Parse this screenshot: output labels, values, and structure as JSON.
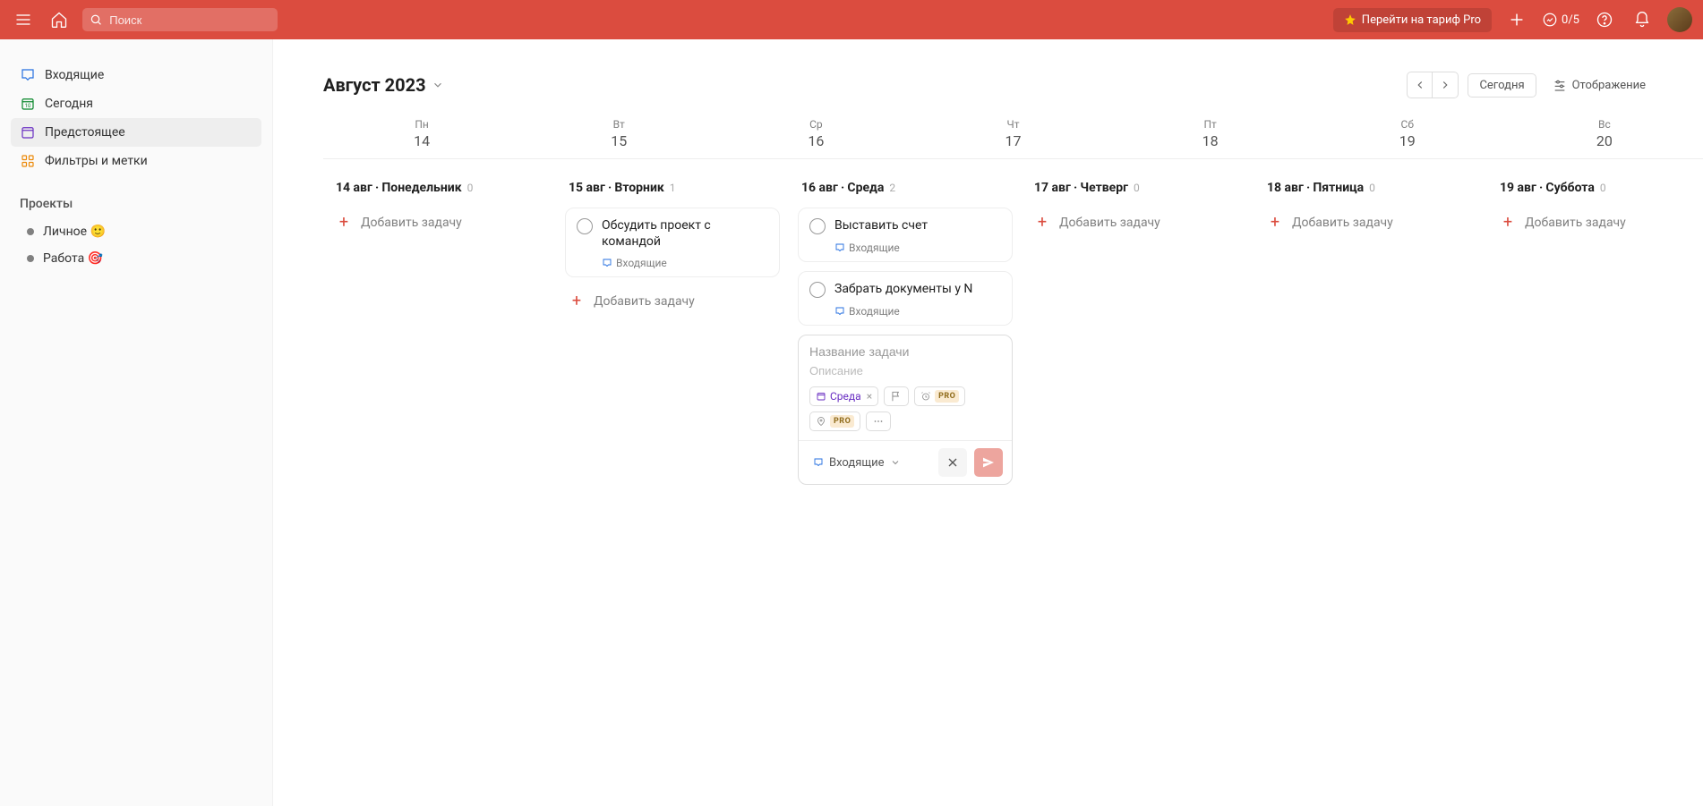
{
  "topbar": {
    "search_placeholder": "Поиск",
    "upgrade_label": "Перейти на тариф Pro",
    "productivity": "0/5"
  },
  "sidebar": {
    "items": [
      {
        "label": "Входящие",
        "icon": "inbox"
      },
      {
        "label": "Сегодня",
        "icon": "today"
      },
      {
        "label": "Предстоящее",
        "icon": "upcoming"
      },
      {
        "label": "Фильтры и метки",
        "icon": "filters"
      }
    ],
    "projects_title": "Проекты",
    "projects": [
      {
        "label": "Личное 🙂"
      },
      {
        "label": "Работа 🎯"
      }
    ]
  },
  "header": {
    "month": "Август 2023",
    "today_label": "Сегодня",
    "view_label": "Отображение"
  },
  "week": [
    {
      "name": "Пн",
      "num": "14"
    },
    {
      "name": "Вт",
      "num": "15"
    },
    {
      "name": "Ср",
      "num": "16"
    },
    {
      "name": "Чт",
      "num": "17"
    },
    {
      "name": "Пт",
      "num": "18"
    },
    {
      "name": "Сб",
      "num": "19"
    },
    {
      "name": "Вс",
      "num": "20"
    }
  ],
  "columns": [
    {
      "title": "14 авг ‧ Понедельник",
      "count": "0",
      "tasks": []
    },
    {
      "title": "15 авг ‧ Вторник",
      "count": "1",
      "tasks": [
        {
          "title": "Обсудить проект с командой",
          "project": "Входящие"
        }
      ]
    },
    {
      "title": "16 авг ‧ Среда",
      "count": "2",
      "tasks": [
        {
          "title": "Выставить счет",
          "project": "Входящие"
        },
        {
          "title": "Забрать документы у N",
          "project": "Входящие"
        }
      ]
    },
    {
      "title": "17 авг ‧ Четверг",
      "count": "0",
      "tasks": []
    },
    {
      "title": "18 авг ‧ Пятница",
      "count": "0",
      "tasks": []
    },
    {
      "title": "19 авг ‧ Суббота",
      "count": "0",
      "tasks": []
    }
  ],
  "add_task_label": "Добавить задачу",
  "quick_add": {
    "title_placeholder": "Название задачи",
    "description_placeholder": "Описание",
    "date_chip": "Среда",
    "pro_label": "PRO",
    "project": "Входящие"
  }
}
